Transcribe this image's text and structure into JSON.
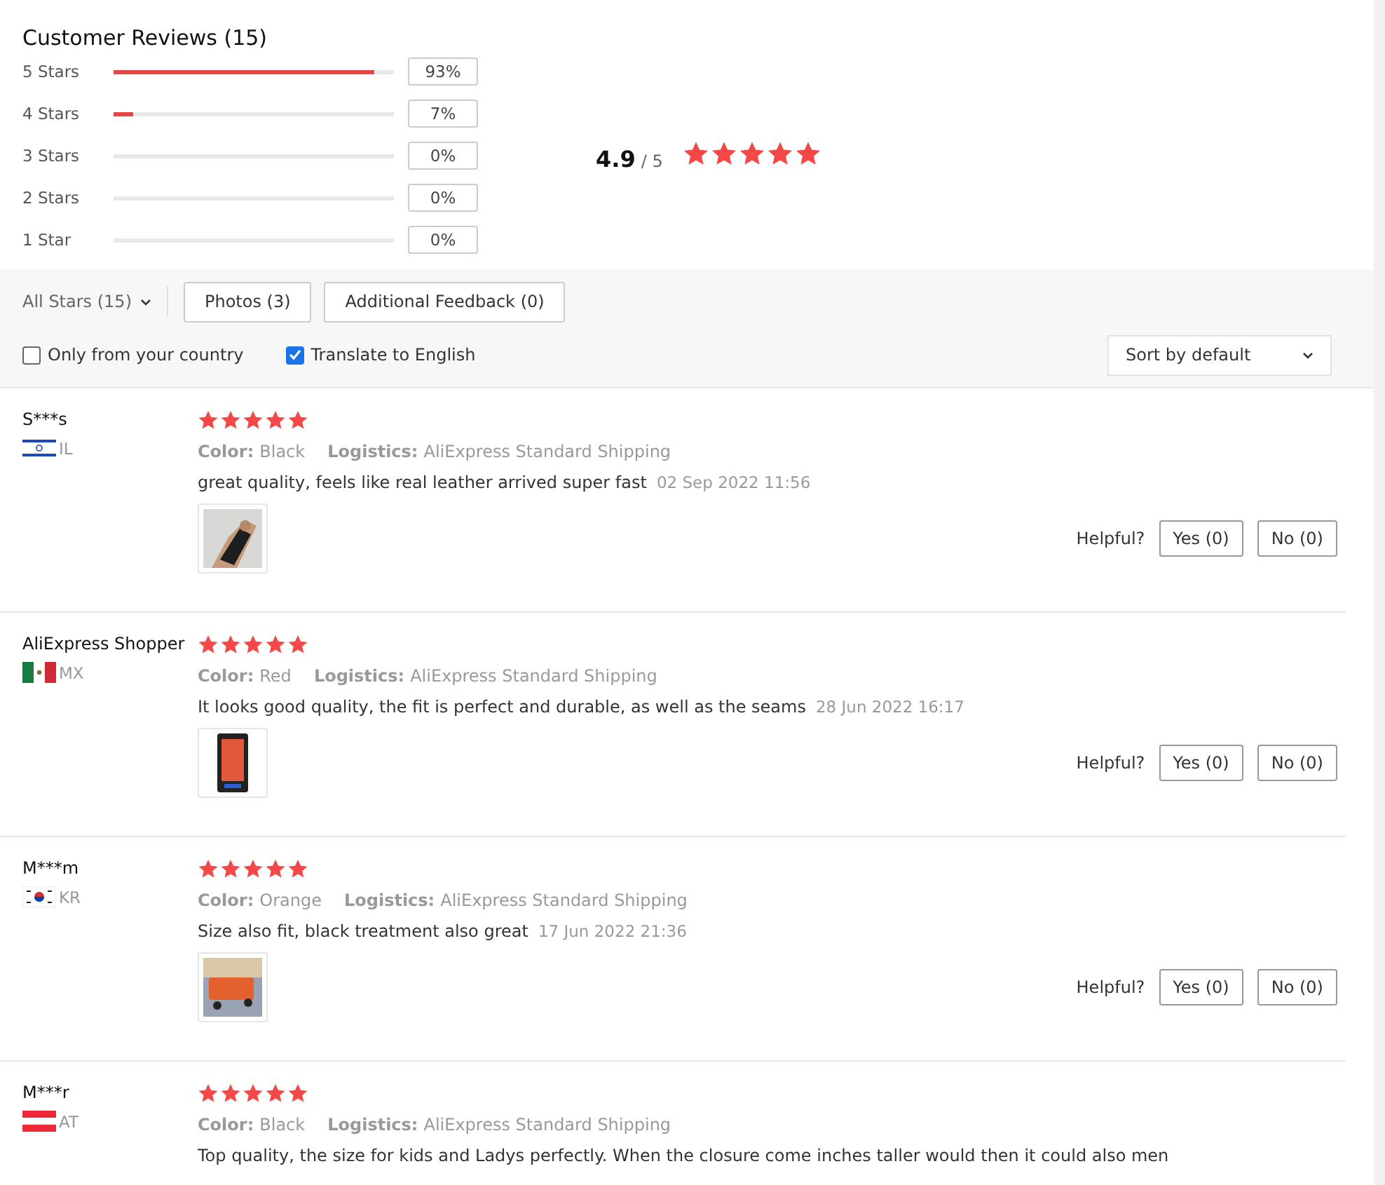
{
  "title": "Customer Reviews (15)",
  "breakdown": [
    {
      "label": "5 Stars",
      "level": 0.93,
      "percent": "93%"
    },
    {
      "label": "4 Stars",
      "level": 0.07,
      "percent": "7%"
    },
    {
      "label": "3 Stars",
      "percent": "0%"
    },
    {
      "label": "2 Stars",
      "percent": "0%"
    },
    {
      "label": "1 Star",
      "percent": "0%"
    }
  ],
  "average": {
    "score": "4.9",
    "out_of": "/ 5",
    "stars": 5
  },
  "filters": {
    "all_stars": "All Stars (15)",
    "buttons": [
      "Photos (3)",
      "Additional Feedback (0)"
    ],
    "checkboxes": [
      {
        "label": "Only from your country",
        "checked": false
      },
      {
        "label": "Translate to English",
        "checked": true
      }
    ],
    "sort": "Sort by default"
  },
  "reviews": [
    {
      "name": "S***s",
      "flag": {
        "kind": "israel"
      },
      "country": "IL",
      "stars": 5,
      "color_label": "Color:",
      "variant": "Black",
      "logistics_label": "Logistics:",
      "logistics": "AliExpress Standard Shipping",
      "text": "great quality, feels like real leather arrived super fast",
      "date": "02 Sep 2022 11:56",
      "helpful": "Helpful?",
      "yes": "Yes (0)",
      "no": "No (0)"
    },
    {
      "name": "AliExpress Shopper",
      "flag": {
        "kind": "mexico"
      },
      "country": "MX",
      "stars": 5,
      "color_label": "Color:",
      "variant": "Red",
      "logistics_label": "Logistics:",
      "logistics": "AliExpress Standard Shipping",
      "text": "It looks good quality, the fit is perfect and durable, as well as the seams",
      "date": "28 Jun 2022 16:17",
      "helpful": "Helpful?",
      "yes": "Yes (0)",
      "no": "No (0)"
    },
    {
      "name": "M***m",
      "flag": {
        "kind": "korea"
      },
      "country": "KR",
      "stars": 5,
      "color_label": "Color:",
      "variant": "Orange",
      "logistics_label": "Logistics:",
      "logistics": "AliExpress Standard Shipping",
      "text": "Size also fit, black treatment also great",
      "date": "17 Jun 2022 21:36",
      "helpful": "Helpful?",
      "yes": "Yes (0)",
      "no": "No (0)"
    },
    {
      "name": "M***r",
      "flag": {
        "kind": "austria"
      },
      "country": "AT",
      "stars": 5,
      "color_label": "Color:",
      "variant": "Black",
      "logistics_label": "Logistics:",
      "logistics": "AliExpress Standard Shipping",
      "text": "Top quality, the size for kids and Ladys perfectly. When the closure come inches taller would then it could also men"
    }
  ]
}
